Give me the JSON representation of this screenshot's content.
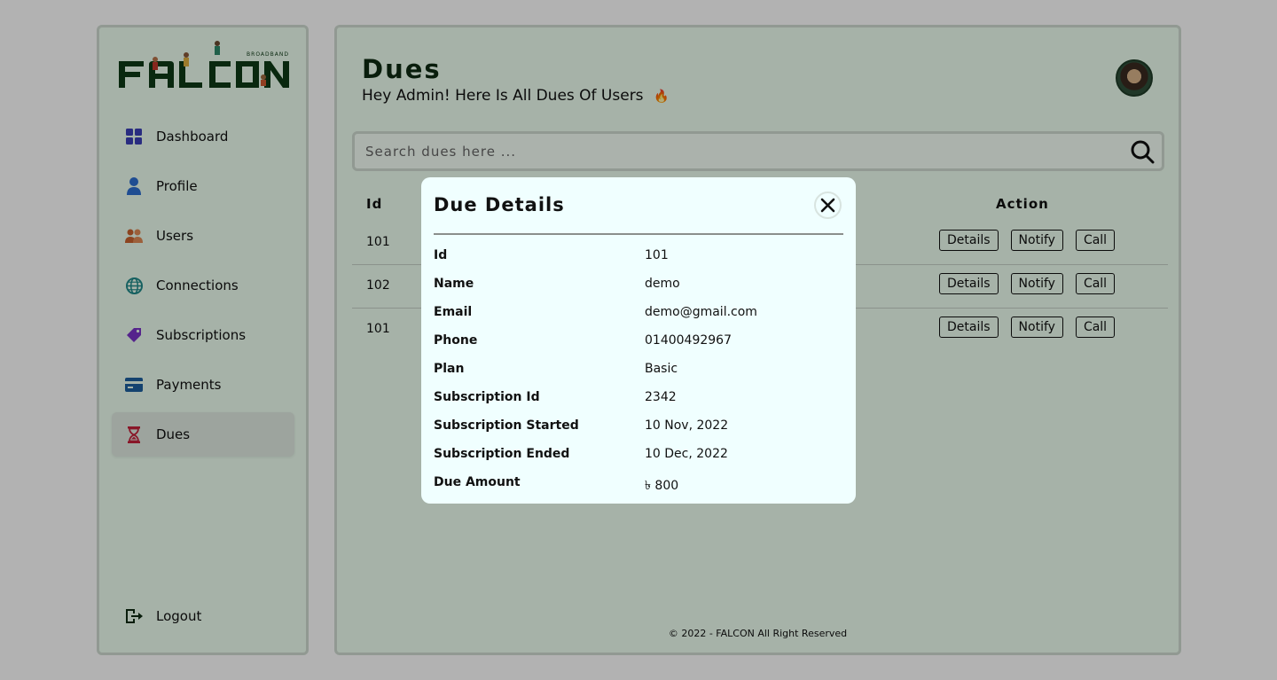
{
  "brand": {
    "name": "FALCON",
    "tagline": "BROADBAND"
  },
  "sidebar": {
    "items": [
      {
        "label": "Dashboard",
        "icon": "dashboard-grid-icon",
        "color": "#3b3fb8"
      },
      {
        "label": "Profile",
        "icon": "user-icon",
        "color": "#2d6fd1"
      },
      {
        "label": "Users",
        "icon": "users-group-icon",
        "color": "#c9622f"
      },
      {
        "label": "Connections",
        "icon": "globe-icon",
        "color": "#1f8a8a"
      },
      {
        "label": "Subscriptions",
        "icon": "tags-icon",
        "color": "#7a33c9"
      },
      {
        "label": "Payments",
        "icon": "credit-card-icon",
        "color": "#1d5fa0"
      },
      {
        "label": "Dues",
        "icon": "hourglass-icon",
        "color": "#c4203a",
        "active": true
      }
    ],
    "logout_label": "Logout"
  },
  "header": {
    "title": "Dues",
    "subtitle": "Hey Admin! Here Is All Dues Of Users",
    "subtitle_emoji": "🔥"
  },
  "search": {
    "placeholder": "Search dues here ...",
    "value": ""
  },
  "table": {
    "headers": {
      "id": "Id",
      "action": "Action"
    },
    "rows": [
      {
        "id": "101"
      },
      {
        "id": "102"
      },
      {
        "id": "101"
      }
    ],
    "buttons": {
      "details": "Details",
      "notify": "Notify",
      "call": "Call"
    }
  },
  "footer": {
    "text": "© 2022 - FALCON All Right Reserved"
  },
  "modal": {
    "title": "Due Details",
    "fields": [
      {
        "label": "Id",
        "value": "101"
      },
      {
        "label": "Name",
        "value": "demo"
      },
      {
        "label": "Email",
        "value": "demo@gmail.com"
      },
      {
        "label": "Phone",
        "value": "01400492967"
      },
      {
        "label": "Plan",
        "value": "Basic"
      },
      {
        "label": "Subscription Id",
        "value": "2342"
      },
      {
        "label": "Subscription Started",
        "value": "10 Nov, 2022"
      },
      {
        "label": "Subscription Ended",
        "value": "10 Dec, 2022"
      },
      {
        "label": "Due Amount",
        "value": "৳ 800"
      }
    ]
  },
  "colors": {
    "panel_bg": "#eefff1",
    "modal_bg": "#f0ffff",
    "brand_dark": "#0d2a12"
  }
}
